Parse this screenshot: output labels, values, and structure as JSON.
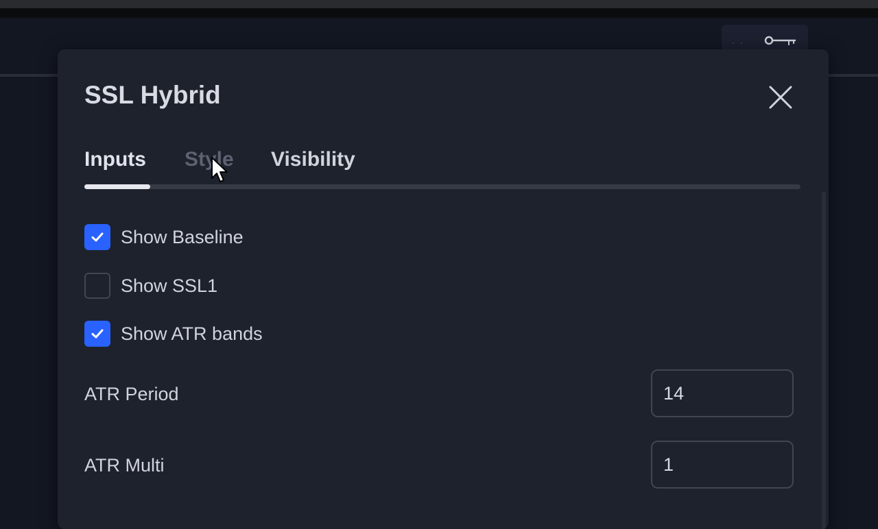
{
  "dialog": {
    "title": "SSL Hybrid",
    "close_icon": "close-icon"
  },
  "tabs": [
    {
      "label": "Inputs",
      "active": true
    },
    {
      "label": "Style",
      "active": false
    },
    {
      "label": "Visibility",
      "active": false
    }
  ],
  "inputs": {
    "show_baseline": {
      "label": "Show Baseline",
      "checked": true
    },
    "show_ssl1": {
      "label": "Show SSL1",
      "checked": false
    },
    "show_atr_bands": {
      "label": "Show ATR bands",
      "checked": true
    },
    "atr_period": {
      "label": "ATR Period",
      "value": "14"
    },
    "atr_multi": {
      "label": "ATR Multi",
      "value": "1"
    }
  },
  "colors": {
    "accent": "#2962ff",
    "dialog_bg": "#1e222d",
    "page_bg": "#131722"
  },
  "icons": [
    "close-icon",
    "check-icon",
    "key-icon",
    "more-dots-icon",
    "mouse-pointer-icon"
  ]
}
